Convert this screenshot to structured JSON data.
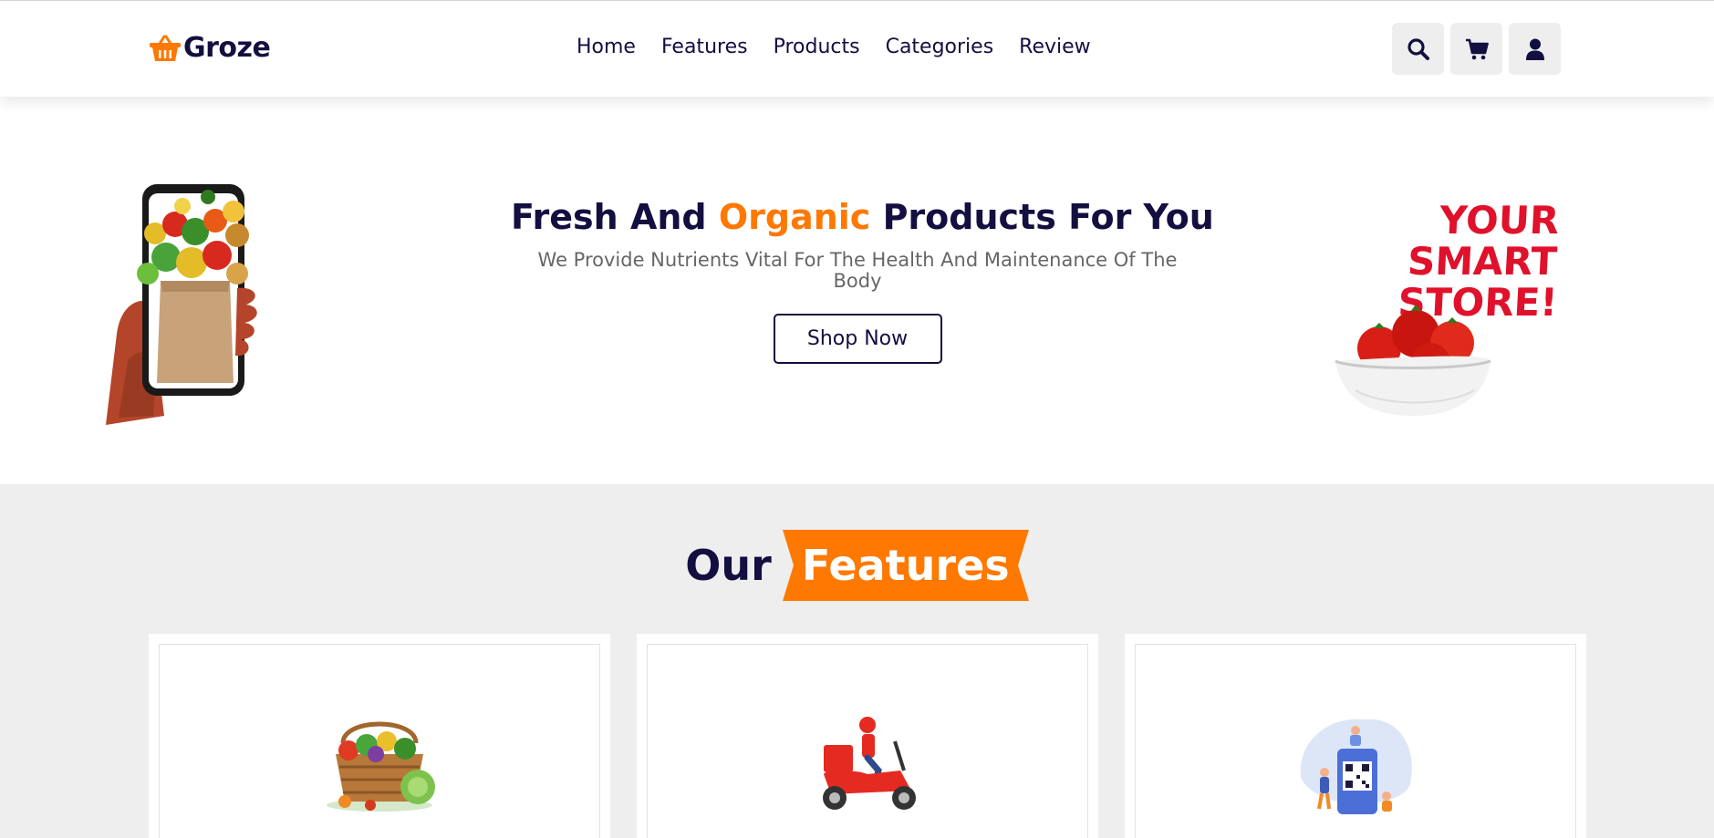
{
  "header": {
    "logo_text": "Groze",
    "logo_icon": "shopping-basket-icon",
    "nav": [
      {
        "label": "Home"
      },
      {
        "label": "Features"
      },
      {
        "label": "Products"
      },
      {
        "label": "Categories"
      },
      {
        "label": "Review"
      }
    ],
    "icons": [
      "search-icon",
      "cart-icon",
      "user-icon"
    ]
  },
  "hero": {
    "title_part1": "Fresh And ",
    "title_accent": "Organic",
    "title_part2": " Products For You",
    "subtitle": "We Provide Nutrients Vital For The Health And Maintenance Of The Body",
    "cta_label": "Shop Now",
    "right_image_text": [
      "YOUR",
      "SMART",
      "STORE!"
    ]
  },
  "features": {
    "heading_plain": "Our",
    "heading_banner": "Features",
    "cards": [
      {
        "image": "vegetable-basket-illustration"
      },
      {
        "image": "delivery-scooter-illustration"
      },
      {
        "image": "qr-payment-illustration"
      }
    ]
  },
  "colors": {
    "primary": "#130f40",
    "accent": "#ff7800",
    "section_bg": "#eeeeee"
  }
}
